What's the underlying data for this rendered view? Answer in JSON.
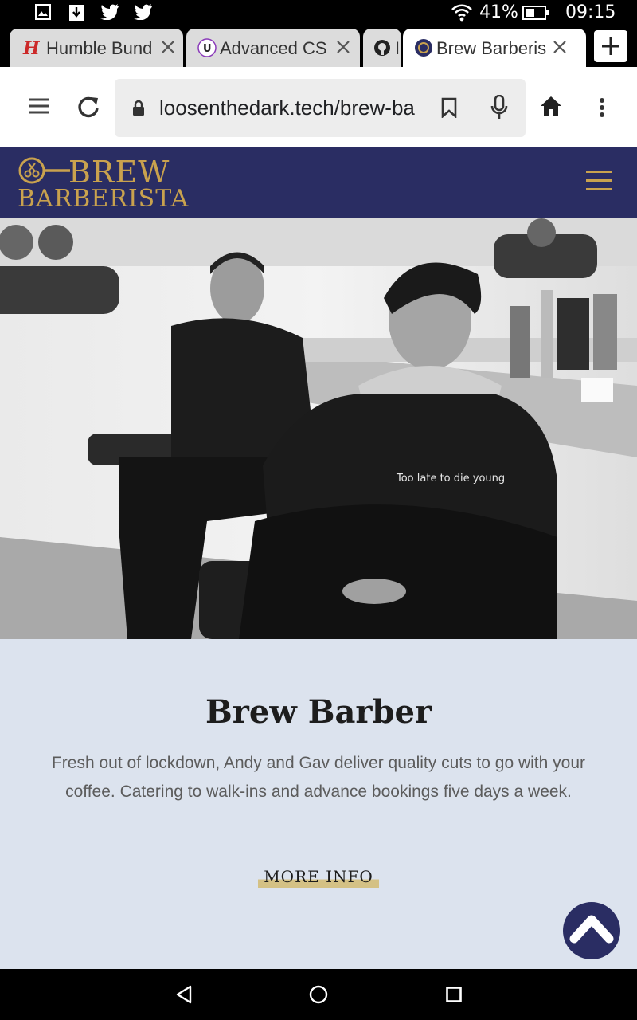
{
  "status_bar": {
    "battery": "41%",
    "time": "09:15",
    "icons": [
      "gallery-icon",
      "download-icon",
      "twitter-icon",
      "twitter-icon",
      "wifi-icon",
      "battery-icon"
    ]
  },
  "tabs": [
    {
      "title": "Humble Bund",
      "icon": "humble-bundle-icon"
    },
    {
      "title": "Advanced CS",
      "icon": "udemy-icon"
    },
    {
      "title": "I",
      "icon": "github-icon"
    },
    {
      "title": "Brew Barberis",
      "icon": "brew-barberista-favicon",
      "active": true
    }
  ],
  "toolbar": {
    "url": "loosenthedark.tech/brew-ba"
  },
  "site": {
    "logo_line1": "BREW",
    "logo_line2": "BARBERISTA",
    "brand_color": "#2a2d63",
    "accent_color": "#c9a24e"
  },
  "hero": {
    "hoodie_text": "Too late to die young"
  },
  "content": {
    "heading": "Brew Barber",
    "description": "Fresh out of lockdown, Andy and Gav deliver quality cuts to go with your coffee. Catering to walk-ins and advance bookings five days a week.",
    "more_info": "MORE INFO"
  }
}
